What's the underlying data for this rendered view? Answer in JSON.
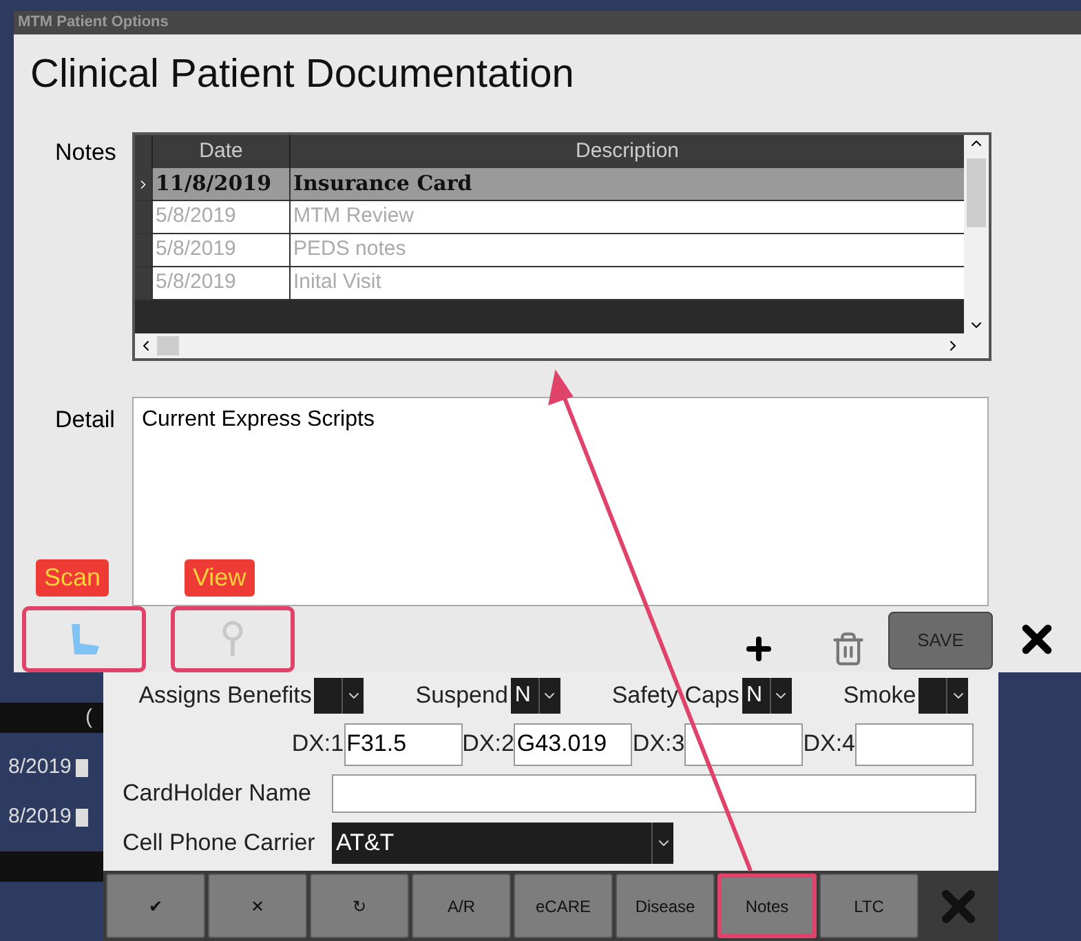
{
  "window": {
    "title": "MTM Patient Options"
  },
  "heading": "Clinical Patient Documentation",
  "notes": {
    "label": "Notes",
    "columns": [
      "Date",
      "Description"
    ],
    "rows": [
      {
        "date": "11/8/2019",
        "description": "Insurance Card",
        "selected": true
      },
      {
        "date": "5/8/2019",
        "description": "MTM Review",
        "selected": false
      },
      {
        "date": "5/8/2019",
        "description": "PEDS notes",
        "selected": false
      },
      {
        "date": "5/8/2019",
        "description": "Inital Visit",
        "selected": false
      }
    ]
  },
  "detail": {
    "label": "Detail",
    "value": "Current Express Scripts"
  },
  "callouts": [
    {
      "label": "Scan",
      "kind": "scan"
    },
    {
      "label": "View",
      "kind": "view"
    }
  ],
  "toolbar": {
    "save": "SAVE"
  },
  "background_rows": [
    {
      "kind": "bar",
      "text": "("
    },
    {
      "kind": "date",
      "text": "8/2019"
    },
    {
      "kind": "date",
      "text": "8/2019"
    },
    {
      "kind": "bar",
      "text": ""
    }
  ],
  "form": {
    "selects": [
      {
        "label": "Assigns Benefits"
      },
      {
        "label": "Suspend",
        "value": "N"
      },
      {
        "label": "Safety Caps",
        "value": "N"
      },
      {
        "label": "Smoke"
      }
    ],
    "dx": [
      {
        "label": "DX:1",
        "value": "F31.5"
      },
      {
        "label": "DX:2",
        "value": "G43.019"
      },
      {
        "label": "DX:3"
      },
      {
        "label": "DX:4"
      }
    ],
    "cardholder": {
      "label": "CardHolder Name"
    },
    "carrier": {
      "label": "Cell Phone Carrier",
      "value": "AT&T"
    },
    "buttons": [
      {
        "label": "✔",
        "highlighted": false
      },
      {
        "label": "✕",
        "highlighted": false
      },
      {
        "label": "↻",
        "highlighted": false
      },
      {
        "label": "A/R",
        "highlighted": false
      },
      {
        "label": "eCARE",
        "highlighted": false
      },
      {
        "label": "Disease",
        "highlighted": false
      },
      {
        "label": "Notes",
        "highlighted": true
      },
      {
        "label": "LTC",
        "highlighted": false
      }
    ]
  }
}
